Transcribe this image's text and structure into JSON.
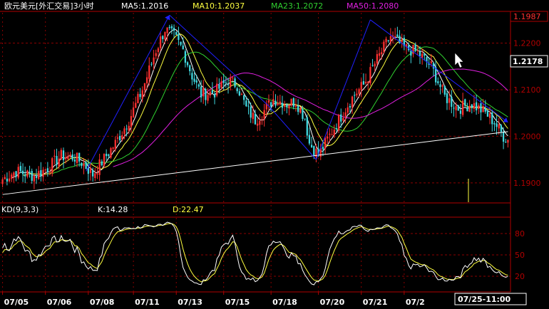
{
  "header": {
    "title": "欧元美元[外汇交易]3小时",
    "ma5": "MA5:1.2016",
    "ma10": "MA10:1.2037",
    "ma23": "MA23:1.2072",
    "ma50": "MA50:1.2080"
  },
  "colors": {
    "background": "#000000",
    "grid": "#8b0000",
    "axis": "#b00000",
    "candle_up": "#ff3030",
    "candle_down": "#40d8e0",
    "ma5": "#ffffff",
    "ma10": "#ffff40",
    "ma23": "#30d030",
    "ma50": "#e020e0",
    "trendline": "#2020ff",
    "neckline": "#ffffff",
    "k_line": "#ffffff",
    "d_line": "#ffff40",
    "label_text": "#ffffff"
  },
  "indicator": {
    "name": "KD(9,3,3)",
    "k_label": "K:14.28",
    "d_label": "D:22.47"
  },
  "cursor_label": "07/25-11:00",
  "chart_data": [
    {
      "type": "candlestick",
      "title": "欧元美元[外汇交易]3小时",
      "y_ticks": [
        "1.1900",
        "1.2000",
        "1.2100",
        "1.2200"
      ],
      "high_label": "1.1987",
      "price_label": "1.2178",
      "ylim": [
        1.186,
        1.2265
      ],
      "x_ticks": [
        "07/05",
        "07/06",
        "07/08",
        "07/11",
        "07/13",
        "07/15",
        "07/18",
        "07/20",
        "07/21",
        "07/2"
      ],
      "x_tick_index": [
        0,
        19,
        38,
        58,
        77,
        98,
        119,
        140,
        159,
        178
      ],
      "candle_count": 200,
      "close_anchors": [
        [
          0,
          1.1908
        ],
        [
          6,
          1.1925
        ],
        [
          14,
          1.1915
        ],
        [
          20,
          1.1932
        ],
        [
          26,
          1.1958
        ],
        [
          32,
          1.1955
        ],
        [
          36,
          1.194
        ],
        [
          40,
          1.1918
        ],
        [
          44,
          1.1945
        ],
        [
          50,
          1.1985
        ],
        [
          56,
          1.2035
        ],
        [
          62,
          1.21
        ],
        [
          68,
          1.2185
        ],
        [
          72,
          1.223
        ],
        [
          76,
          1.2215
        ],
        [
          80,
          1.2185
        ],
        [
          84,
          1.213
        ],
        [
          88,
          1.209
        ],
        [
          94,
          1.2095
        ],
        [
          100,
          1.212
        ],
        [
          104,
          1.211
        ],
        [
          108,
          1.206
        ],
        [
          112,
          1.2035
        ],
        [
          116,
          1.2055
        ],
        [
          120,
          1.208
        ],
        [
          126,
          1.207
        ],
        [
          130,
          1.2075
        ],
        [
          134,
          1.204
        ],
        [
          136,
          1.1985
        ],
        [
          140,
          1.196
        ],
        [
          146,
          1.201
        ],
        [
          152,
          1.206
        ],
        [
          156,
          1.209
        ],
        [
          160,
          1.211
        ],
        [
          166,
          1.2165
        ],
        [
          172,
          1.2215
        ],
        [
          178,
          1.219
        ],
        [
          184,
          1.218
        ],
        [
          190,
          1.215
        ],
        [
          196,
          1.2085
        ],
        [
          202,
          1.206
        ],
        [
          208,
          1.207
        ],
        [
          214,
          1.205
        ],
        [
          218,
          1.203
        ],
        [
          222,
          1.2
        ],
        [
          224,
          1.1993
        ]
      ],
      "ma_series": [
        {
          "name": "MA5",
          "period": 5
        },
        {
          "name": "MA10",
          "period": 10
        },
        {
          "name": "MA23",
          "period": 23
        },
        {
          "name": "MA50",
          "period": 50
        }
      ],
      "trendlines": [
        {
          "kind": "neckline",
          "points": [
            [
              0,
              1.1875
            ],
            [
              224,
              1.201
            ]
          ]
        },
        {
          "kind": "channel",
          "points": [
            [
              37,
              1.1925
            ],
            [
              74,
              1.226
            ]
          ]
        },
        {
          "kind": "channel",
          "points": [
            [
              74,
              1.226
            ],
            [
              118,
              1.2065
            ]
          ]
        },
        {
          "kind": "channel",
          "points": [
            [
              118,
              1.2065
            ],
            [
              139,
              1.195
            ]
          ]
        },
        {
          "kind": "channel",
          "points": [
            [
              139,
              1.195
            ],
            [
              163,
              1.225
            ]
          ]
        },
        {
          "kind": "channel",
          "points": [
            [
              163,
              1.225
            ],
            [
              224,
              1.203
            ]
          ]
        }
      ]
    },
    {
      "type": "line",
      "title": "KD(9,3,3)",
      "y_ticks": [
        20,
        50,
        80
      ],
      "ylim": [
        0,
        100
      ],
      "series": [
        {
          "name": "K",
          "values_ref": "computed"
        },
        {
          "name": "D",
          "values_ref": "computed"
        }
      ]
    }
  ]
}
